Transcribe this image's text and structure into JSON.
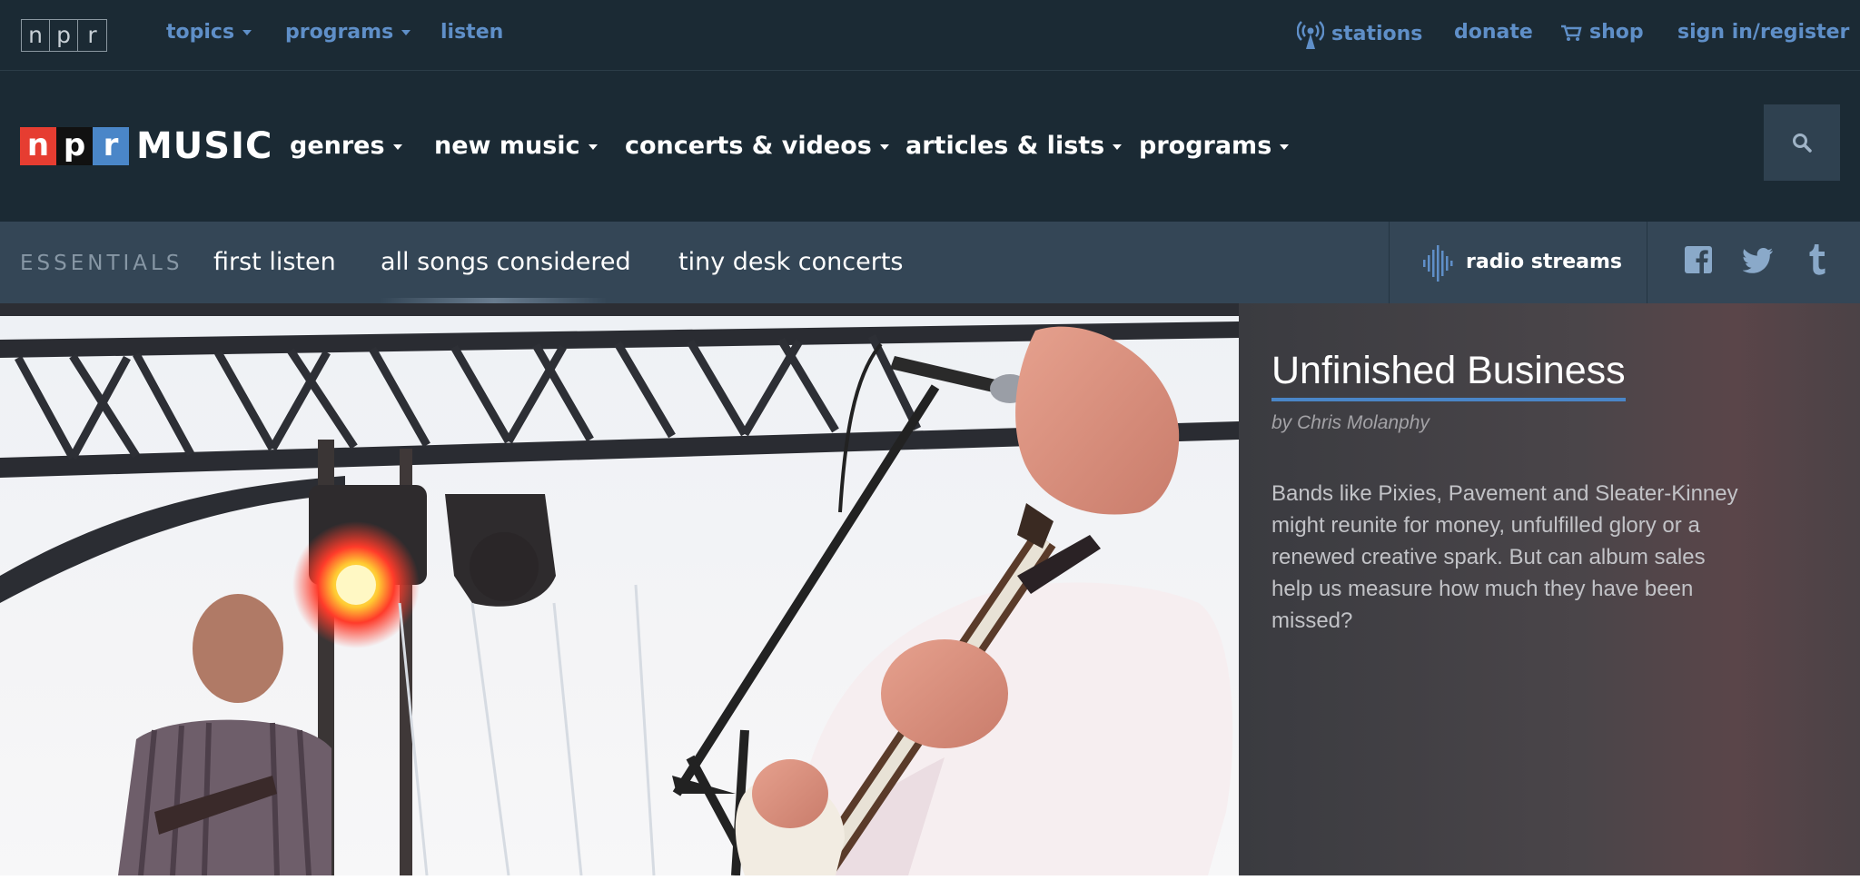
{
  "topbar": {
    "brand_letters": [
      "n",
      "p",
      "r"
    ],
    "left_links": [
      {
        "label": "topics",
        "has_dropdown": true
      },
      {
        "label": "programs",
        "has_dropdown": true
      },
      {
        "label": "listen",
        "has_dropdown": false
      }
    ],
    "right_links": [
      {
        "label": "stations",
        "icon": "radio-tower-icon"
      },
      {
        "label": "donate"
      },
      {
        "label": "shop",
        "icon": "cart-icon"
      },
      {
        "label": "sign in/register"
      }
    ],
    "link_color": "#5f8fc8",
    "background": "#1b2a34"
  },
  "mainnav": {
    "logo": {
      "letters": [
        "n",
        "p",
        "r"
      ],
      "word": "MUSIC",
      "colors": {
        "n": "#e63d31",
        "p": "#111111",
        "r": "#4a86c8"
      }
    },
    "items": [
      {
        "label": "genres"
      },
      {
        "label": "new music"
      },
      {
        "label": "concerts & videos"
      },
      {
        "label": "articles & lists"
      },
      {
        "label": "programs"
      }
    ],
    "search_icon": "search-icon"
  },
  "essentials": {
    "label": "ESSENTIALS",
    "links": [
      "first listen",
      "all songs considered",
      "tiny desk concerts"
    ],
    "active_index": 1,
    "radio_streams": "radio streams",
    "social": [
      "facebook-icon",
      "twitter-icon",
      "tumblr-icon"
    ]
  },
  "hero": {
    "title": "Unfinished Business",
    "byline": "by Chris Molanphy",
    "description": "Bands like Pixies, Pavement and Sleater-Kinney might reunite for money, unfulfilled glory or a renewed creative spark. But can album sales help us measure how much they have been missed?",
    "image_subject": "concert-photo",
    "accent": "#4a86c8"
  }
}
